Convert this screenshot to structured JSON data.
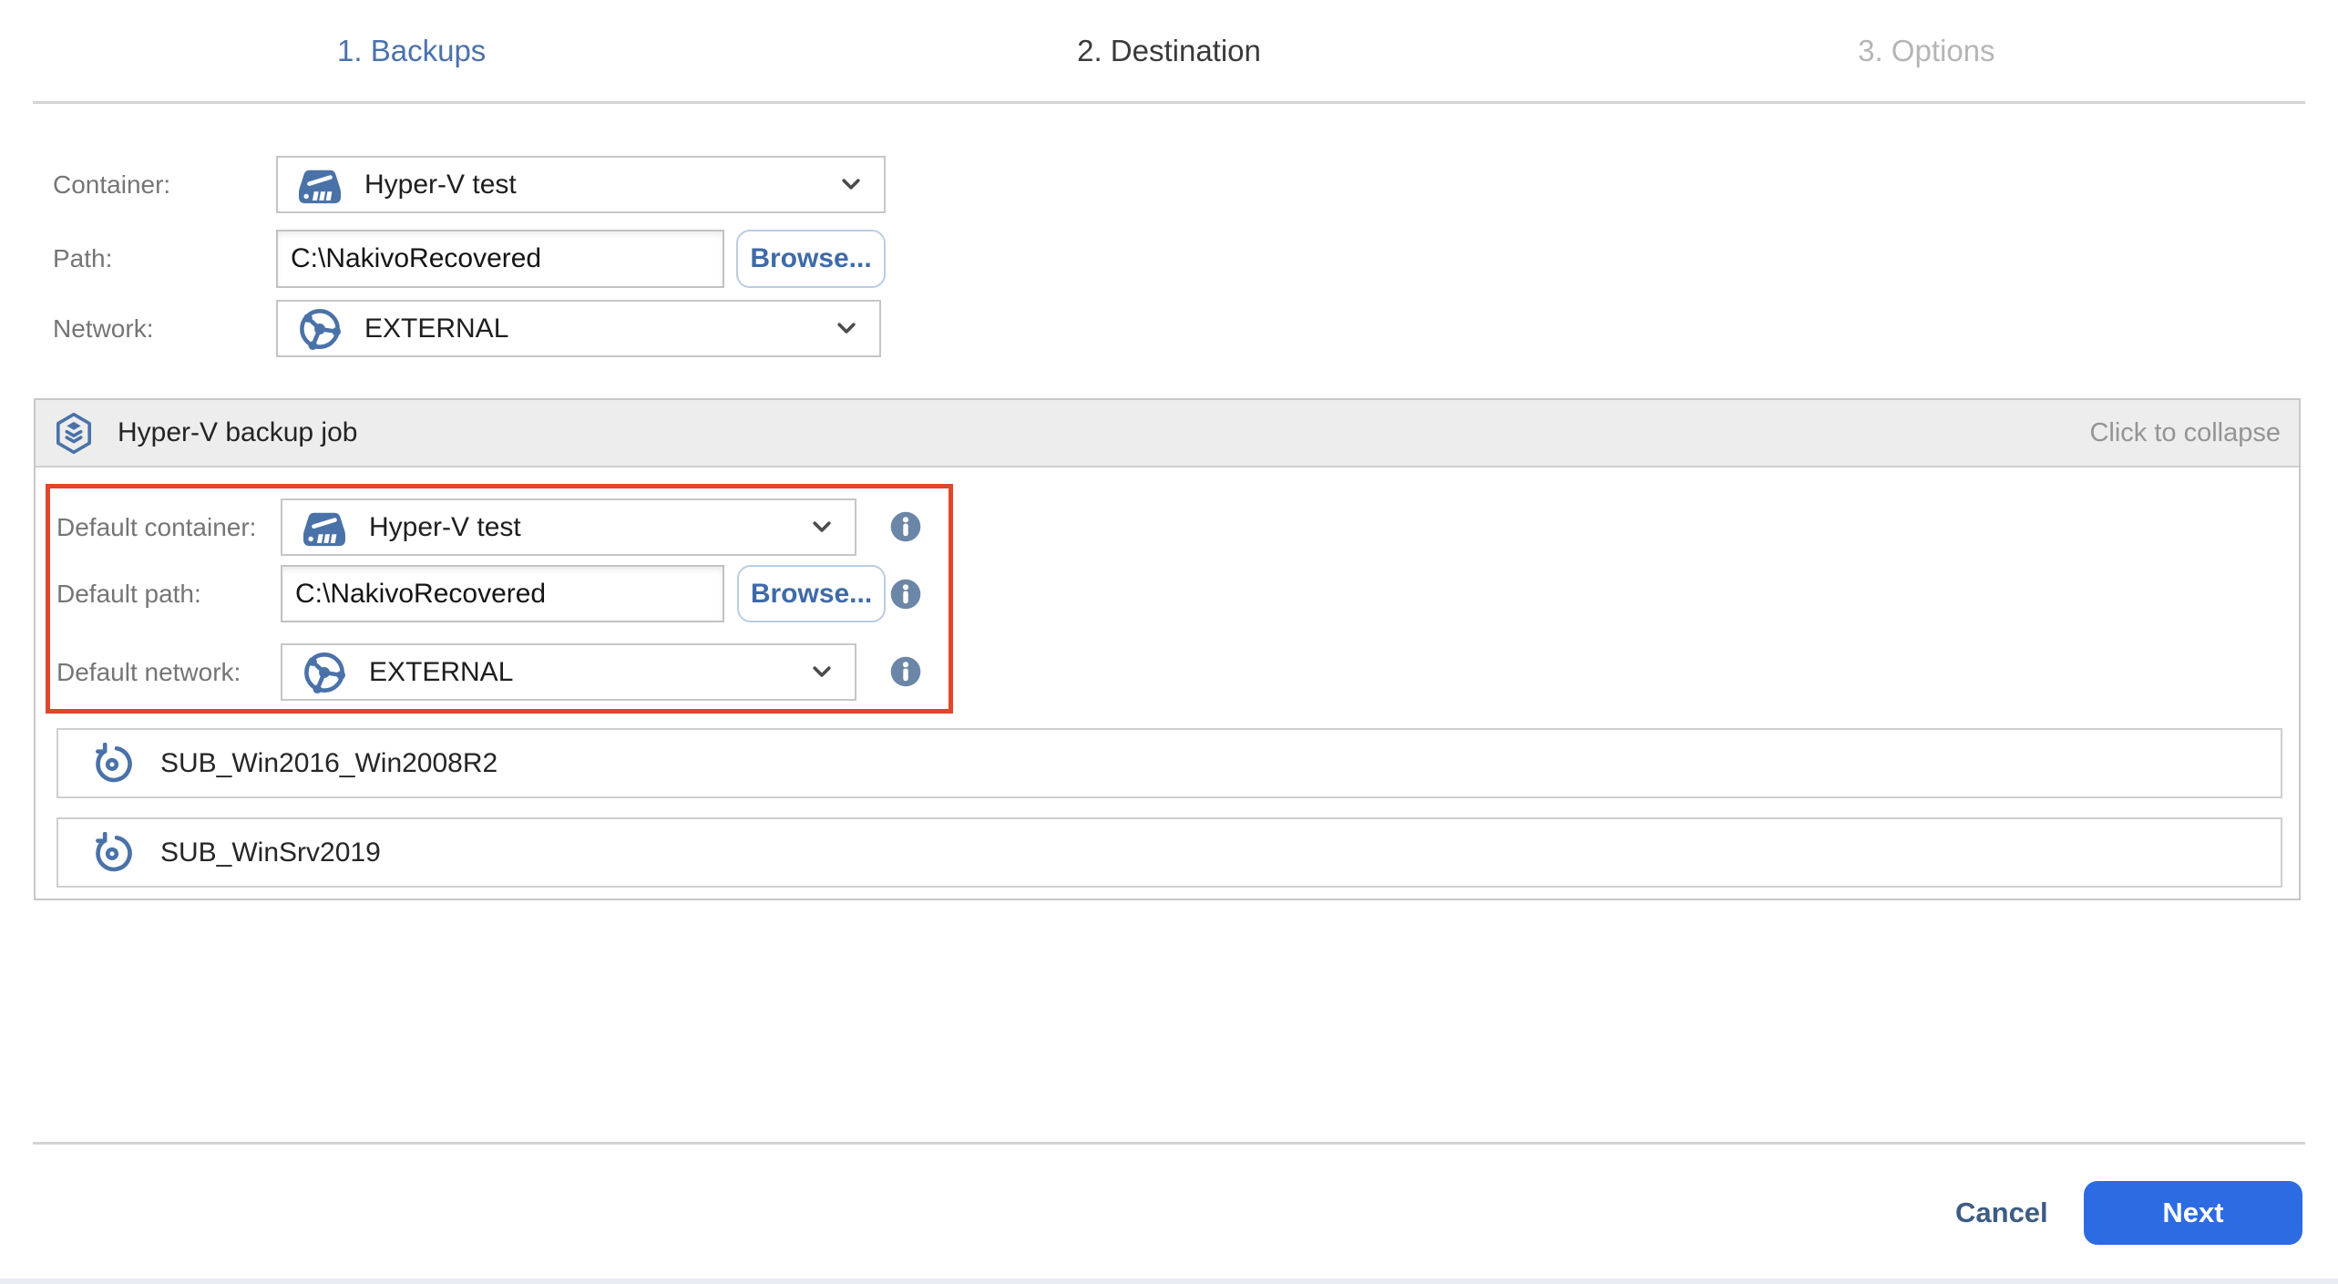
{
  "wizard": {
    "steps": [
      {
        "label": "1. Backups"
      },
      {
        "label": "2. Destination"
      },
      {
        "label": "3. Options"
      }
    ]
  },
  "destination_form": {
    "container": {
      "label": "Container:",
      "value": "Hyper-V test"
    },
    "path": {
      "label": "Path:",
      "value": "C:\\NakivoRecovered",
      "browse_label": "Browse..."
    },
    "network": {
      "label": "Network:",
      "value": "EXTERNAL"
    }
  },
  "job_panel": {
    "title": "Hyper-V backup job",
    "collapse_hint": "Click to collapse",
    "defaults": {
      "container": {
        "label": "Default container:",
        "value": "Hyper-V test"
      },
      "path": {
        "label": "Default path:",
        "value": "C:\\NakivoRecovered",
        "browse_label": "Browse..."
      },
      "network": {
        "label": "Default network:",
        "value": "EXTERNAL"
      }
    },
    "backups": [
      {
        "name": "SUB_Win2016_Win2008R2"
      },
      {
        "name": "SUB_WinSrv2019"
      }
    ]
  },
  "footer": {
    "cancel_label": "Cancel",
    "next_label": "Next"
  },
  "icons": {
    "container_dropdown": "hyperv-host-icon",
    "network_dropdown": "network-globe-icon",
    "job_header": "backup-job-stack-icon",
    "backup_row": "restore-arrow-icon",
    "field_help": "info-icon",
    "dropdown_caret": "chevron-down-icon"
  },
  "colors": {
    "step_active_blue": "#4a72ad",
    "icon_steel_blue": "#4a72a8",
    "info_icon_blue": "#6b86a6",
    "highlight_red": "#e2462c",
    "browse_text_blue": "#3e6aa8",
    "next_button_blue": "#2c6be2",
    "cancel_text_blue": "#3c5c84",
    "panel_header_gray": "#ededed"
  }
}
